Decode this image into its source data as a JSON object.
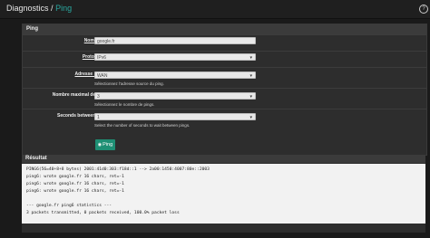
{
  "breadcrumb": {
    "parent": "Diagnostics",
    "sep": "/",
    "current": "Ping"
  },
  "form": {
    "title": "Ping",
    "host": {
      "label": "Nom d'hôte",
      "value": "google.fr"
    },
    "protocol": {
      "label": "Protocole IP",
      "value": "IPv6"
    },
    "source": {
      "label": "Adresse source",
      "value": "WAN",
      "help": "Sélectionnez l'adresse source du ping."
    },
    "count": {
      "label": "Nombre maximal de pings",
      "value": "3",
      "help": "Sélectionnez le nombre de pings."
    },
    "seconds": {
      "label": "Seconds between pings",
      "value": "1",
      "help": "Select the number of seconds to wait between pings."
    },
    "submit": "Ping"
  },
  "result": {
    "title": "Résultat",
    "lines": [
      "PING6(56=40+8+8 bytes) 2001:41d0:303:f18d::1 --> 2a00:1450:4007:80e::2003",
      "ping6: wrote google.fr 16 chars, ret=-1",
      "ping6: wrote google.fr 16 chars, ret=-1",
      "ping6: wrote google.fr 16 chars, ret=-1",
      "",
      "--- google.fr ping6 statistics ---",
      "3 packets transmitted, 0 packets received, 100.0% packet loss"
    ]
  }
}
